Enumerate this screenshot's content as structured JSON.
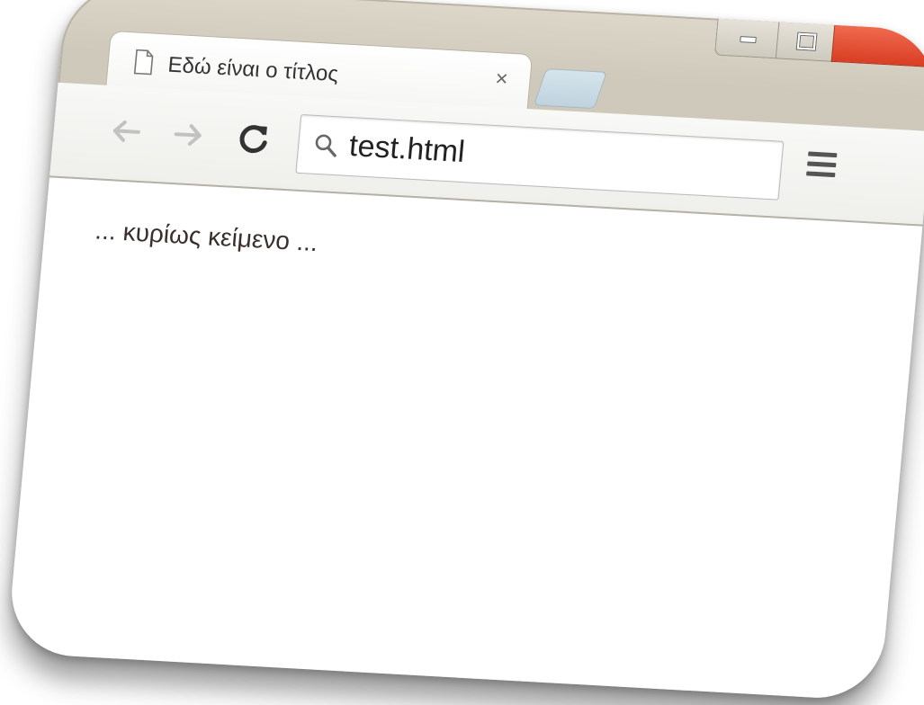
{
  "browser": {
    "tab": {
      "title": "Εδώ είναι ο τίτλος",
      "close_glyph": "×",
      "page_icon": "page-icon"
    },
    "address_bar": {
      "icon": "search-icon",
      "value": "test.html"
    },
    "toolbar_icons": [
      "back-arrow-icon",
      "forward-arrow-icon",
      "reload-icon",
      "menu-icon"
    ],
    "window_controls": [
      "minimize",
      "maximize",
      "close"
    ]
  },
  "page": {
    "body_text": "... κυρίως κείμενο ..."
  },
  "colors": {
    "close_button": "#e04a2e",
    "new_tab": "#c9dbe5"
  }
}
